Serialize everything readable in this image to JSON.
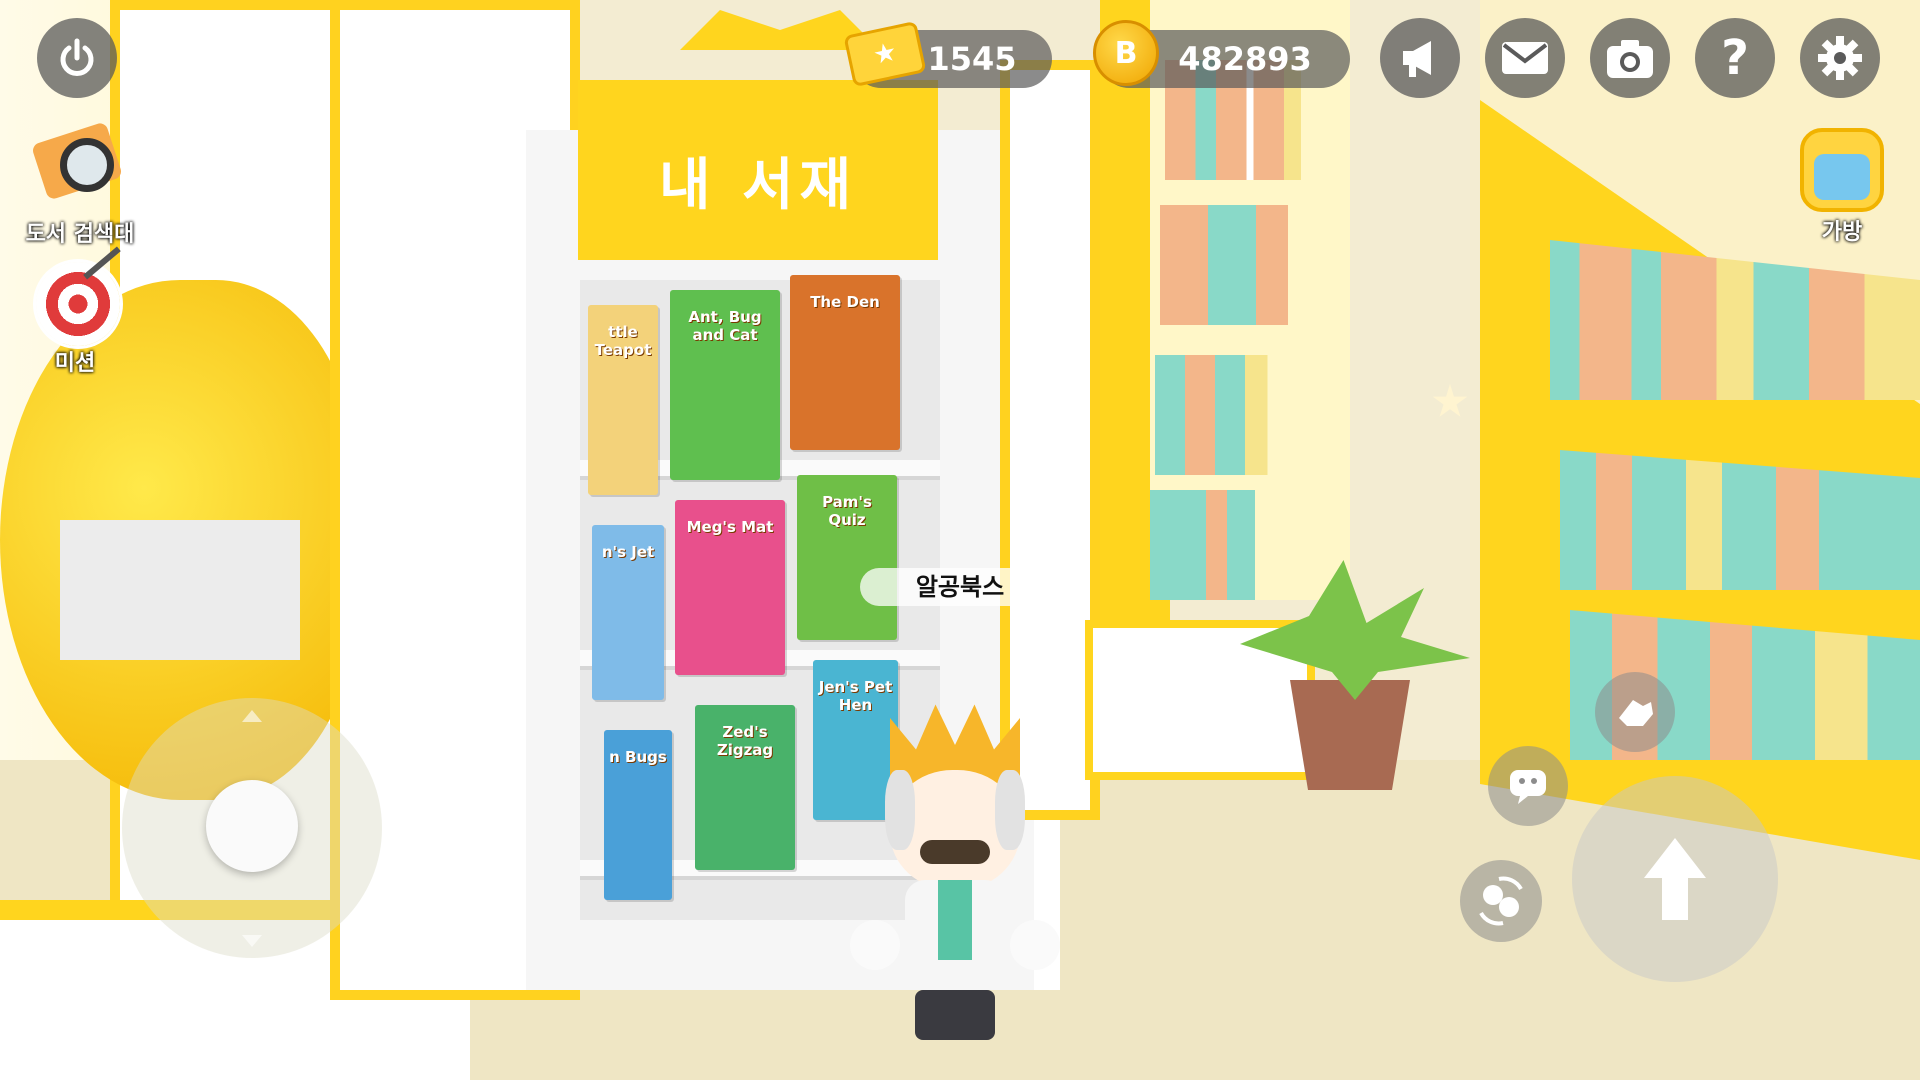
{
  "hud": {
    "tickets": "1545",
    "coins": "482893",
    "coin_symbol": "B",
    "buttons": [
      "power-icon",
      "megaphone-icon",
      "mail-icon",
      "camera-icon",
      "help-icon",
      "gear-icon"
    ]
  },
  "left_menu": {
    "search_label": "도서 검색대",
    "mission_label": "미션"
  },
  "right_menu": {
    "bag_label": "가방"
  },
  "bookshelf": {
    "sign": "내 서재",
    "books": [
      {
        "title": "ttle Teapot",
        "color": "#f3d27a"
      },
      {
        "title": "Ant, Bug and Cat",
        "color": "#5fbf4f"
      },
      {
        "title": "The Den",
        "color": "#d9732b"
      },
      {
        "title": "n's Jet",
        "color": "#7fbbe8"
      },
      {
        "title": "Meg's Mat",
        "color": "#e8508c"
      },
      {
        "title": "Pam's Quiz",
        "color": "#6fbf47"
      },
      {
        "title": "n Bugs",
        "color": "#4aa0d8"
      },
      {
        "title": "Zed's Zigzag",
        "color": "#49b26a"
      },
      {
        "title": "Jen's Pet Hen",
        "color": "#4ab5d2"
      }
    ]
  },
  "npc": {
    "name": "알공북스"
  },
  "colors": {
    "accent_yellow": "#ffd51e",
    "hud_gray": "#5a5a5a"
  }
}
